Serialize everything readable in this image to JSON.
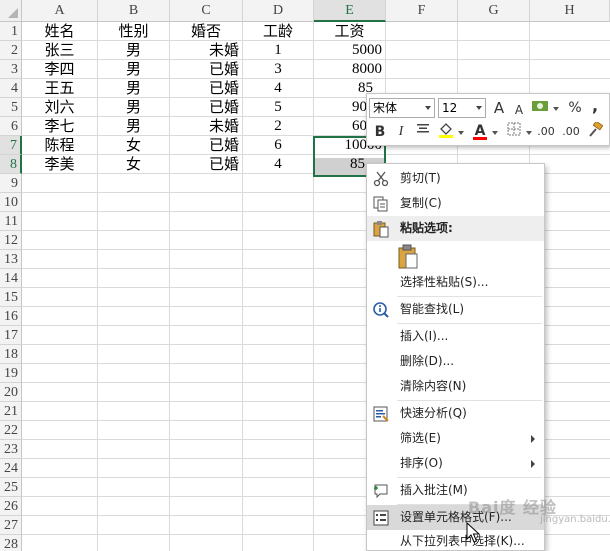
{
  "columns": [
    "A",
    "B",
    "C",
    "D",
    "E",
    "F",
    "G",
    "H"
  ],
  "rows": [
    "1",
    "2",
    "3",
    "4",
    "5",
    "6",
    "7",
    "8",
    "9",
    "10",
    "11",
    "12",
    "13",
    "14",
    "15",
    "16",
    "17",
    "18",
    "19",
    "20",
    "21",
    "22",
    "23",
    "24",
    "25",
    "26",
    "27",
    "28"
  ],
  "table": {
    "headers": [
      "姓名",
      "性别",
      "婚否",
      "工龄",
      "工资"
    ],
    "data": [
      [
        "张三",
        "男",
        "未婚",
        "1",
        "5000"
      ],
      [
        "李四",
        "男",
        "已婚",
        "3",
        "8000"
      ],
      [
        "王五",
        "男",
        "已婚",
        "4",
        "8500"
      ],
      [
        "刘六",
        "男",
        "已婚",
        "5",
        "9000"
      ],
      [
        "李七",
        "男",
        "未婚",
        "2",
        "6000"
      ],
      [
        "陈程",
        "女",
        "已婚",
        "6",
        "10000"
      ],
      [
        "李美",
        "女",
        "已婚",
        "4",
        "8500"
      ]
    ]
  },
  "visible_salary": [
    "5000",
    "8000",
    "85",
    "90",
    "60",
    "10000",
    "85"
  ],
  "selection": {
    "range": "E7:E8"
  },
  "mini_toolbar": {
    "font_name": "宋体",
    "font_size": "12",
    "grow_font": "A",
    "shrink_font": "A",
    "percent": "%",
    "comma": ",",
    "bold": "B",
    "italic": "I",
    "font_color_letter": "A",
    "inc_decimal": ".00",
    "dec_decimal": ".00",
    "fill_color": "#ffff00",
    "font_color": "#ff0000"
  },
  "context_menu": {
    "items": [
      {
        "label": "剪切(T)",
        "icon": "scissors-icon"
      },
      {
        "label": "复制(C)",
        "icon": "copy-icon"
      },
      {
        "label": "粘贴选项:",
        "icon": "clipboard-icon"
      },
      {
        "label": "",
        "icon": "paste-clipboard-icon"
      },
      {
        "label": "选择性粘贴(S)...",
        "icon": ""
      },
      {
        "label": "智能查找(L)",
        "icon": "smart-lookup-icon"
      },
      {
        "label": "插入(I)...",
        "icon": ""
      },
      {
        "label": "删除(D)...",
        "icon": ""
      },
      {
        "label": "清除内容(N)",
        "icon": ""
      },
      {
        "label": "快速分析(Q)",
        "icon": "quick-analysis-icon"
      },
      {
        "label": "筛选(E)",
        "icon": ""
      },
      {
        "label": "排序(O)",
        "icon": ""
      },
      {
        "label": "插入批注(M)",
        "icon": "comment-icon"
      },
      {
        "label": "设置单元格格式(F)...",
        "icon": "format-cells-icon"
      },
      {
        "label": "从下拉列表中选择(K)...",
        "icon": ""
      }
    ]
  },
  "watermark": {
    "text": "Bai度 经验",
    "sub": "jingyan.baidu.com"
  }
}
